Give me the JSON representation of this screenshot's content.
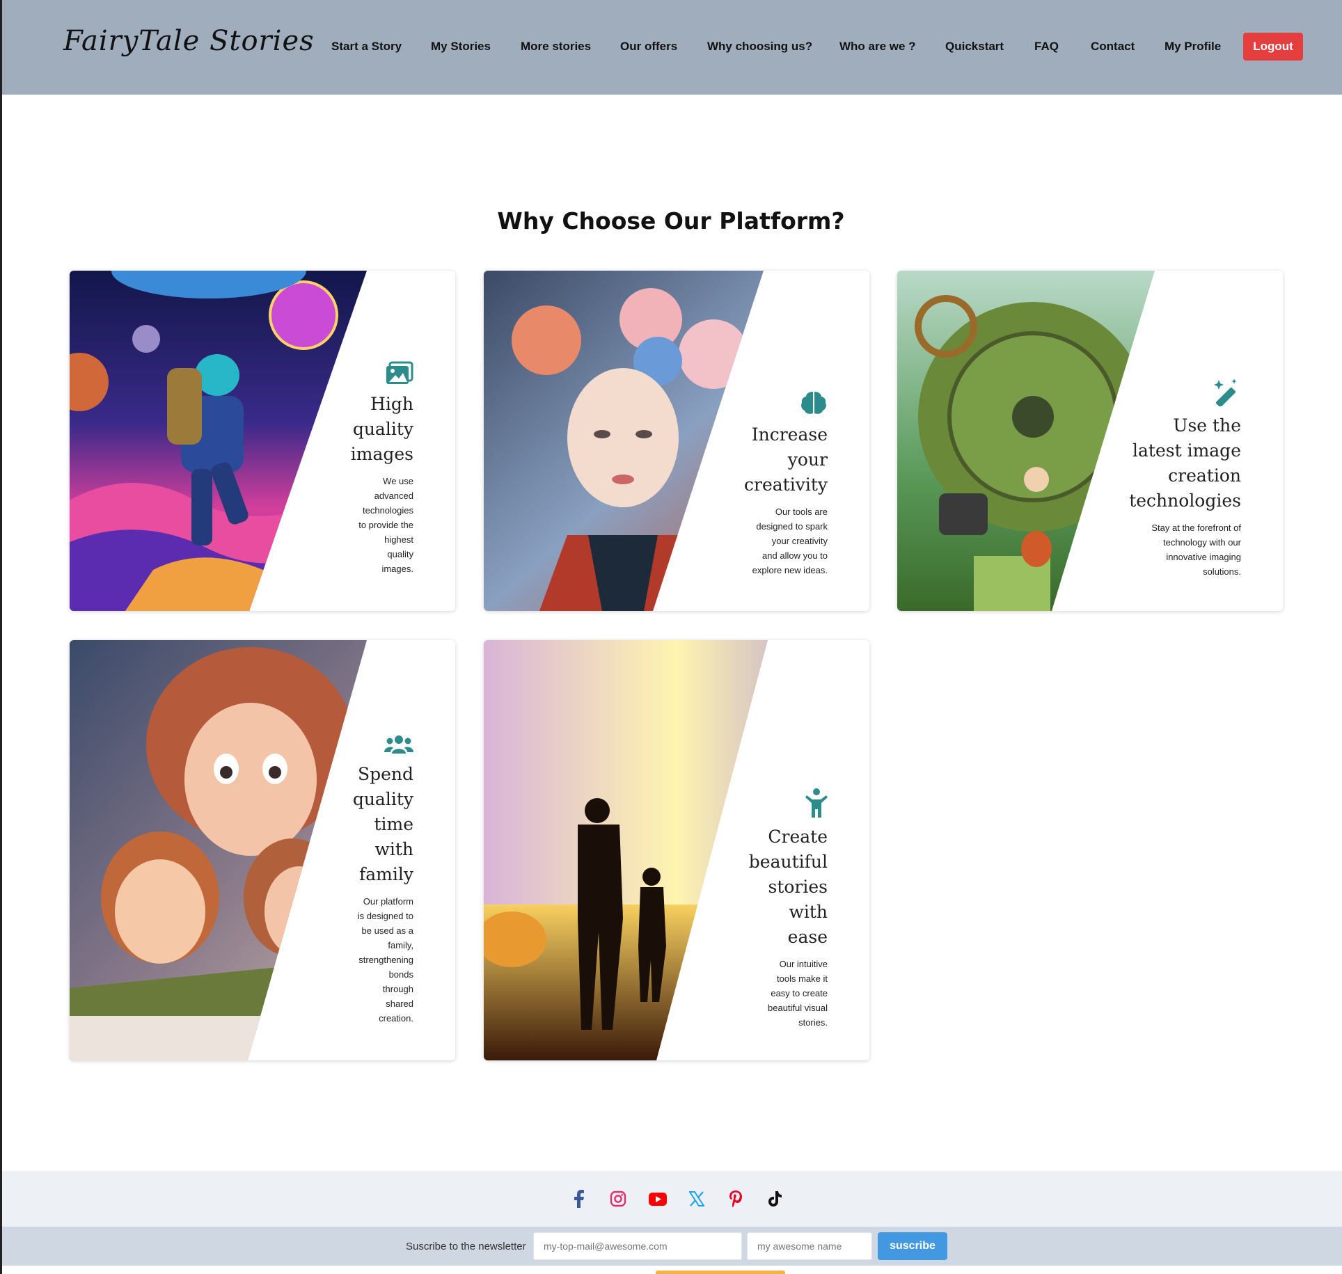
{
  "header": {
    "logo": "FairyTale Stories",
    "nav": [
      "Start a Story",
      "My Stories",
      "More stories",
      "Our offers",
      "Why choosing us?",
      "Who are we ?",
      "Quickstart",
      "FAQ",
      "Contact",
      "My Profile"
    ],
    "logout_label": "Logout",
    "bg_color": "#a0adbd",
    "logout_color": "#e53e3e"
  },
  "main": {
    "title": "Why Choose Our Platform?",
    "accent_color": "#2c8c8c",
    "cards": [
      {
        "icon": "images-icon",
        "heading": [
          "High",
          "quality",
          "images"
        ],
        "desc": [
          "We use",
          "advanced",
          "technologies",
          "to provide the",
          "highest",
          "quality",
          "images."
        ],
        "image": "astronaut-space-illustration"
      },
      {
        "icon": "brain-icon",
        "heading": [
          "Increase",
          "your",
          "creativity"
        ],
        "desc": [
          "Our tools are",
          "designed to spark",
          "your creativity",
          "and allow you to",
          "explore new ideas."
        ],
        "image": "floral-woman-portrait-illustration"
      },
      {
        "icon": "magic-wand-icon",
        "heading": [
          "Use the",
          "latest image",
          "creation",
          "technologies"
        ],
        "desc": [
          "Stay at the forefront of",
          "technology with our",
          "innovative imaging",
          "solutions."
        ],
        "image": "steampunk-machine-girl-guitar-illustration"
      },
      {
        "icon": "users-icon",
        "heading": [
          "Spend",
          "quality",
          "time",
          "with",
          "family"
        ],
        "desc": [
          "Our platform",
          "is designed to",
          "be used as a",
          "family,",
          "strengthening",
          "bonds",
          "through",
          "shared",
          "creation."
        ],
        "image": "family-reading-book-illustration"
      },
      {
        "icon": "child-icon",
        "heading": [
          "Create",
          "beautiful",
          "stories",
          "with",
          "ease"
        ],
        "desc": [
          "Our intuitive",
          "tools make it",
          "easy to create",
          "beautiful visual",
          "stories."
        ],
        "image": "father-son-sunset-illustration"
      }
    ]
  },
  "footer": {
    "social": [
      {
        "icon": "facebook-icon",
        "color": "#3b5998"
      },
      {
        "icon": "instagram-icon",
        "color": "#e1306c"
      },
      {
        "icon": "youtube-icon",
        "color": "#ff0000"
      },
      {
        "icon": "x-twitter-icon",
        "color": "#1da1f2"
      },
      {
        "icon": "pinterest-icon",
        "color": "#e60023"
      },
      {
        "icon": "tiktok-icon",
        "color": "#111111"
      }
    ],
    "newsletter": {
      "label": "Suscribe to the newsletter",
      "email_placeholder": "my-top-mail@awesome.com",
      "name_placeholder": "my awesome name",
      "button_label": "suscribe",
      "button_color": "#4299e1"
    }
  }
}
